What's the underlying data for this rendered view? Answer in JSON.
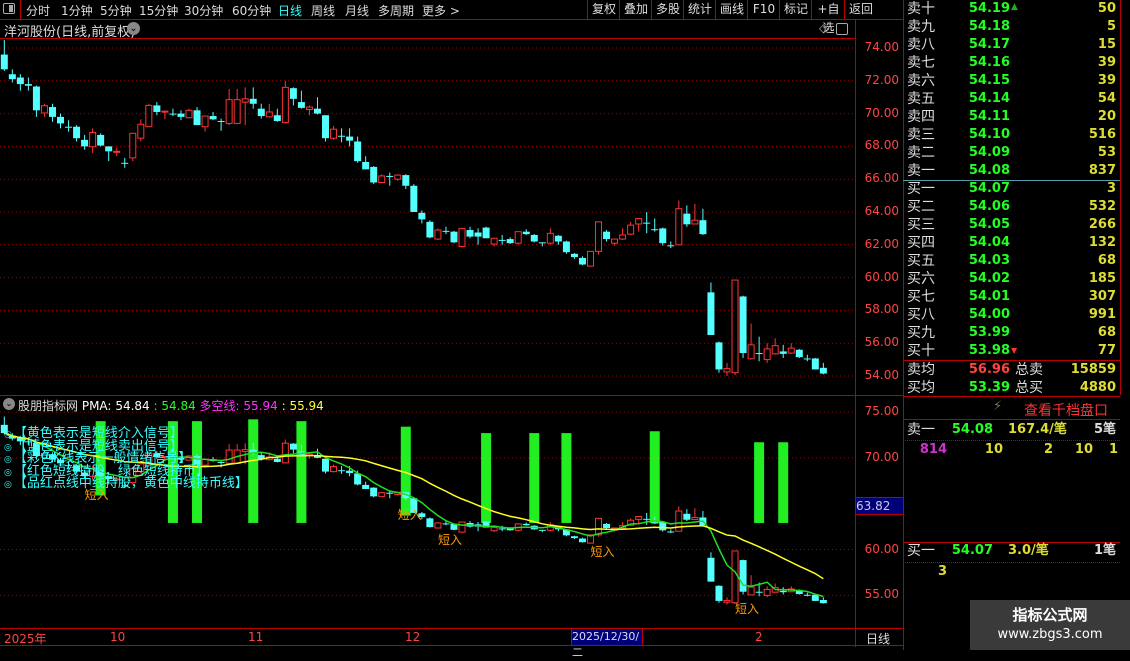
{
  "toolbar": {
    "periods": [
      "分时",
      "1分钟",
      "5分钟",
      "15分钟",
      "30分钟",
      "60分钟",
      "日线",
      "周线",
      "月线",
      "多周期",
      "更多 >"
    ],
    "active_period": "日线",
    "buttons": [
      "复权",
      "叠加",
      "多股",
      "统计",
      "画线",
      "F10",
      "标记",
      "+自选",
      "返回"
    ]
  },
  "main_chart": {
    "title": "洋河股份(日线,前复权)",
    "price_ticks": [
      "74.00",
      "72.00",
      "70.00",
      "68.00",
      "66.00",
      "64.00",
      "62.00",
      "60.00",
      "58.00",
      "56.00",
      "54.00"
    ],
    "colors": {
      "up": "#ff3333",
      "down": "#54ffff",
      "grid": "#a00000",
      "doji": "#ffffff"
    }
  },
  "chart_data": {
    "type": "candlestick",
    "period": "daily",
    "ylim": [
      53.5,
      74.5
    ],
    "candles": [
      [
        73.6,
        74.5,
        72.6,
        72.7
      ],
      [
        72.4,
        72.7,
        71.9,
        72.1
      ],
      [
        72.2,
        72.4,
        71.4,
        71.8
      ],
      [
        71.8,
        72.2,
        71.4,
        71.7
      ],
      [
        71.65,
        71.7,
        69.8,
        70.2
      ],
      [
        70.04,
        70.6,
        69.8,
        70.48
      ],
      [
        70.4,
        70.6,
        69.5,
        69.8
      ],
      [
        69.8,
        70.0,
        69.1,
        69.4
      ],
      [
        69.2,
        69.6,
        68.9,
        69.2
      ],
      [
        69.2,
        69.3,
        68.3,
        68.5
      ],
      [
        68.4,
        68.7,
        67.8,
        68.0
      ],
      [
        67.98,
        69.1,
        67.6,
        68.85
      ],
      [
        68.7,
        68.8,
        68.0,
        68.05
      ],
      [
        68.0,
        68.0,
        67.1,
        67.7
      ],
      [
        67.65,
        67.9,
        67.4,
        67.7
      ],
      [
        67.0,
        67.3,
        66.7,
        67.0
      ],
      [
        67.3,
        68.8,
        67.1,
        68.8
      ],
      [
        68.5,
        69.65,
        68.3,
        69.35
      ],
      [
        69.2,
        70.6,
        69.2,
        70.5
      ],
      [
        70.5,
        70.7,
        69.9,
        70.1
      ],
      [
        70.1,
        70.15,
        69.65,
        70.15
      ],
      [
        70.0,
        70.3,
        69.85,
        70.0
      ],
      [
        70.0,
        70.2,
        69.6,
        69.8
      ],
      [
        69.75,
        70.3,
        69.7,
        70.2
      ],
      [
        70.2,
        70.4,
        69.3,
        69.3
      ],
      [
        69.2,
        69.85,
        68.9,
        69.85
      ],
      [
        69.85,
        70.1,
        69.6,
        69.65
      ],
      [
        69.55,
        69.7,
        68.95,
        69.55
      ],
      [
        69.4,
        71.5,
        69.3,
        70.85
      ],
      [
        69.4,
        71.5,
        69.35,
        70.85
      ],
      [
        70.7,
        71.6,
        69.3,
        70.9
      ],
      [
        70.9,
        71.6,
        70.3,
        70.6
      ],
      [
        70.3,
        70.6,
        69.7,
        69.85
      ],
      [
        69.8,
        70.6,
        69.75,
        70.1
      ],
      [
        69.9,
        70.3,
        69.5,
        69.55
      ],
      [
        69.45,
        72.0,
        69.4,
        71.6
      ],
      [
        71.55,
        71.6,
        70.5,
        70.9
      ],
      [
        70.7,
        71.4,
        70.3,
        70.35
      ],
      [
        70.25,
        70.5,
        69.9,
        70.4
      ],
      [
        70.3,
        71.0,
        69.95,
        70.0
      ],
      [
        69.9,
        69.9,
        68.3,
        68.5
      ],
      [
        68.5,
        69.25,
        68.4,
        69.05
      ],
      [
        68.65,
        69.1,
        68.25,
        68.65
      ],
      [
        68.6,
        69.1,
        68.0,
        68.35
      ],
      [
        68.3,
        68.6,
        67.0,
        67.1
      ],
      [
        67.05,
        67.4,
        66.6,
        66.6
      ],
      [
        66.75,
        66.8,
        65.7,
        65.8
      ],
      [
        65.8,
        66.3,
        65.8,
        66.2
      ],
      [
        66.2,
        66.4,
        65.6,
        66.2
      ],
      [
        66.0,
        66.3,
        65.9,
        66.25
      ],
      [
        66.25,
        66.3,
        65.4,
        65.6
      ],
      [
        65.6,
        65.7,
        64.0,
        64.0
      ],
      [
        63.95,
        64.1,
        63.3,
        63.55
      ],
      [
        63.4,
        63.5,
        62.4,
        62.45
      ],
      [
        62.35,
        63.0,
        62.3,
        62.9
      ],
      [
        62.85,
        63.1,
        62.65,
        62.85
      ],
      [
        62.8,
        62.85,
        62.1,
        62.15
      ],
      [
        61.9,
        63.0,
        61.85,
        63.0
      ],
      [
        62.9,
        63.1,
        62.4,
        62.5
      ],
      [
        62.75,
        63.0,
        62.0,
        62.5
      ],
      [
        63.05,
        63.1,
        62.4,
        62.4
      ],
      [
        62.05,
        62.4,
        61.9,
        62.4
      ],
      [
        62.3,
        62.6,
        62.0,
        62.3
      ],
      [
        62.35,
        62.45,
        62.05,
        62.1
      ],
      [
        62.1,
        62.8,
        62.0,
        62.8
      ],
      [
        62.8,
        62.95,
        62.6,
        62.65
      ],
      [
        62.6,
        62.65,
        62.15,
        62.2
      ],
      [
        62.15,
        62.15,
        61.9,
        62.15
      ],
      [
        62.1,
        63.0,
        62.0,
        62.7
      ],
      [
        62.55,
        62.6,
        62.0,
        62.2
      ],
      [
        62.2,
        62.25,
        61.45,
        61.55
      ],
      [
        61.45,
        61.5,
        61.15,
        61.25
      ],
      [
        61.2,
        61.3,
        60.75,
        60.8
      ],
      [
        60.7,
        61.6,
        60.7,
        61.6
      ],
      [
        61.6,
        63.4,
        61.4,
        63.4
      ],
      [
        62.8,
        62.9,
        62.2,
        62.35
      ],
      [
        62.1,
        62.35,
        61.95,
        62.35
      ],
      [
        62.35,
        63.0,
        62.3,
        62.6
      ],
      [
        62.65,
        63.4,
        62.6,
        63.2
      ],
      [
        63.27,
        63.6,
        62.8,
        63.6
      ],
      [
        63.35,
        64.0,
        62.7,
        63.35
      ],
      [
        62.95,
        63.6,
        62.8,
        62.95
      ],
      [
        63.0,
        63.05,
        61.95,
        62.1
      ],
      [
        61.97,
        62.2,
        61.8,
        61.97
      ],
      [
        62.0,
        64.7,
        62.0,
        64.2
      ],
      [
        63.9,
        64.4,
        63.1,
        63.25
      ],
      [
        63.27,
        64.5,
        63.25,
        63.5
      ],
      [
        63.5,
        64.2,
        62.6,
        62.65
      ],
      [
        59.1,
        59.7,
        56.5,
        56.5
      ],
      [
        56.05,
        56.1,
        54.2,
        54.4
      ],
      [
        54.25,
        54.8,
        54.0,
        54.45
      ],
      [
        54.2,
        59.85,
        54.05,
        59.85
      ],
      [
        58.85,
        58.9,
        55.1,
        55.4
      ],
      [
        55.05,
        57.2,
        55.0,
        55.9
      ],
      [
        55.4,
        56.4,
        54.9,
        55.4
      ],
      [
        55.0,
        56.0,
        54.8,
        55.65
      ],
      [
        55.35,
        56.3,
        55.3,
        55.85
      ],
      [
        55.5,
        55.9,
        55.1,
        55.35
      ],
      [
        55.4,
        56.0,
        55.35,
        55.7
      ],
      [
        55.6,
        55.65,
        55.1,
        55.15
      ],
      [
        55.07,
        55.3,
        54.9,
        55.07
      ],
      [
        55.07,
        55.1,
        54.4,
        54.4
      ],
      [
        54.5,
        54.8,
        54.1,
        54.15
      ]
    ],
    "indicator": {
      "name": "股朋指标网",
      "ylim": [
        53.0,
        76.0
      ],
      "ticks": [
        "75.00",
        "70.00",
        "60.00",
        "55.00"
      ],
      "highlight_value": "63.82",
      "signal_bars": [
        {
          "index": 12,
          "top": 74.0,
          "bottom": 65.9
        },
        {
          "index": 21,
          "top": 74.0,
          "bottom": 62.9
        },
        {
          "index": 24,
          "top": 74.0,
          "bottom": 62.9
        },
        {
          "index": 31,
          "top": 74.2,
          "bottom": 62.9
        },
        {
          "index": 37,
          "top": 74.0,
          "bottom": 62.9
        },
        {
          "index": 50,
          "top": 73.4,
          "bottom": 63.7
        },
        {
          "index": 60,
          "top": 72.7,
          "bottom": 62.9
        },
        {
          "index": 66,
          "top": 72.7,
          "bottom": 62.9
        },
        {
          "index": 70,
          "top": 72.7,
          "bottom": 62.9
        },
        {
          "index": 81,
          "top": 72.9,
          "bottom": 62.9
        },
        {
          "index": 94,
          "top": 71.7,
          "bottom": 62.9
        },
        {
          "index": 97,
          "top": 71.7,
          "bottom": 62.9
        }
      ],
      "short_entry_label": "短入",
      "short_entry_indices": [
        11,
        50,
        55,
        74,
        92
      ],
      "line_colors": {
        "fast": "#22dd22",
        "slow": "#ffff22",
        "signal_bar": "#22ee22"
      }
    }
  },
  "indicator_header": {
    "title": "股朋指标网",
    "pma_label": "PMA:",
    "pma_value1": "54.84",
    "pma_value2": ": 54.84",
    "dk_label": "多空线:",
    "dk_value1": "55.94",
    "dk_value2": ": 55.94"
  },
  "legend_lines": [
    "【黄色表示是短线介入信号】",
    "【蓝色表示是短线卖出信号】",
    "【彩色K线表示一般情绪信号】",
    "【红色短线持股，绿色短线持币】",
    "【品红点线中线持股，黄色中线持币线】"
  ],
  "time_axis": {
    "labels": [
      "2025年",
      "10",
      "11",
      "12",
      "2",
      "日线"
    ],
    "cursor_date": "2025/12/30/二"
  },
  "order_book": {
    "asks": [
      {
        "label": "卖十",
        "price": "54.19",
        "vol": "50"
      },
      {
        "label": "卖九",
        "price": "54.18",
        "vol": "5"
      },
      {
        "label": "卖八",
        "price": "54.17",
        "vol": "15"
      },
      {
        "label": "卖七",
        "price": "54.16",
        "vol": "39"
      },
      {
        "label": "卖六",
        "price": "54.15",
        "vol": "39"
      },
      {
        "label": "卖五",
        "price": "54.14",
        "vol": "54"
      },
      {
        "label": "卖四",
        "price": "54.11",
        "vol": "20"
      },
      {
        "label": "卖三",
        "price": "54.10",
        "vol": "516"
      },
      {
        "label": "卖二",
        "price": "54.09",
        "vol": "53"
      },
      {
        "label": "卖一",
        "price": "54.08",
        "vol": "837"
      }
    ],
    "bids": [
      {
        "label": "买一",
        "price": "54.07",
        "vol": "3"
      },
      {
        "label": "买二",
        "price": "54.06",
        "vol": "532"
      },
      {
        "label": "买三",
        "price": "54.05",
        "vol": "266"
      },
      {
        "label": "买四",
        "price": "54.04",
        "vol": "132"
      },
      {
        "label": "买五",
        "price": "54.03",
        "vol": "68"
      },
      {
        "label": "买六",
        "price": "54.02",
        "vol": "185"
      },
      {
        "label": "买七",
        "price": "54.01",
        "vol": "307"
      },
      {
        "label": "买八",
        "price": "54.00",
        "vol": "991"
      },
      {
        "label": "买九",
        "price": "53.99",
        "vol": "68"
      },
      {
        "label": "买十",
        "price": "53.98",
        "vol": "77"
      }
    ],
    "avg_sell": {
      "label": "卖均",
      "price": "56.96",
      "total_label": "总卖",
      "total": "15859"
    },
    "avg_buy": {
      "label": "买均",
      "price": "53.39",
      "total_label": "总买",
      "total": "4880"
    },
    "thousand_levels_label": "查看千档盘口",
    "sell1_detail": {
      "label": "卖一",
      "price": "54.08",
      "per_order": "167.4/笔",
      "orders": "5笔",
      "queue": [
        "814",
        "10",
        "2",
        "10",
        "1"
      ]
    },
    "buy1_detail": {
      "label": "买一",
      "price": "54.07",
      "per_order": "3.0/笔",
      "orders": "1笔",
      "queue": [
        "3"
      ]
    }
  },
  "watermark": {
    "title": "指标公式网",
    "url": "www.zbgs3.com"
  }
}
